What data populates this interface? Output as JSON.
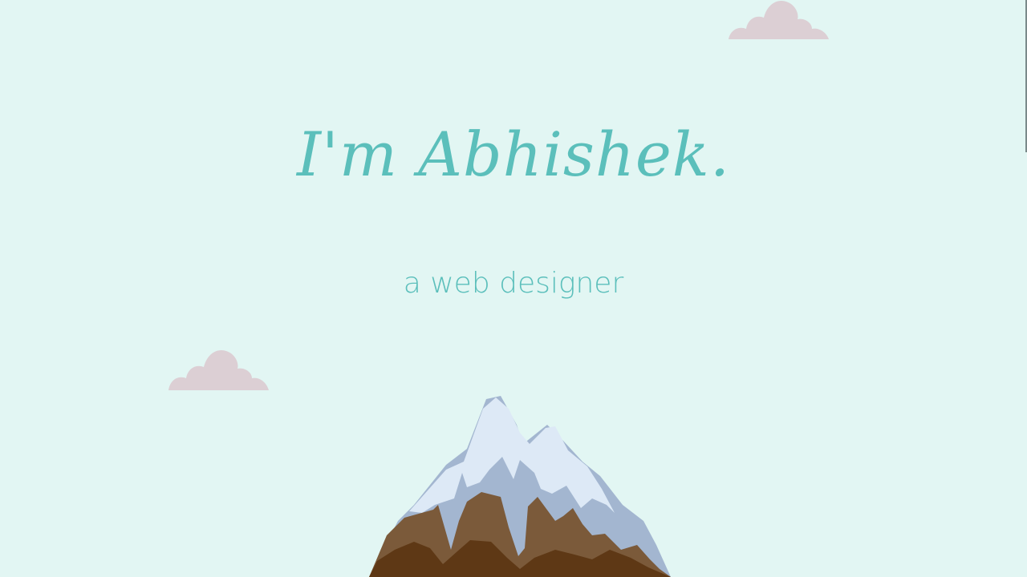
{
  "hero": {
    "headline": "I'm Abhishek.",
    "tagline": "a web designer"
  },
  "colors": {
    "background": "#e2f6f3",
    "accent_text": "#5bbfbb",
    "cloud": "#dccfd4",
    "snow": "#dde9f6",
    "snow_shadow": "#a3b6d0",
    "rock": "#7b5a3a",
    "rock_dark": "#5e3815"
  },
  "decorations": {
    "clouds": [
      "cloud-icon",
      "cloud-icon"
    ],
    "illustration": "mountain-illustration"
  }
}
